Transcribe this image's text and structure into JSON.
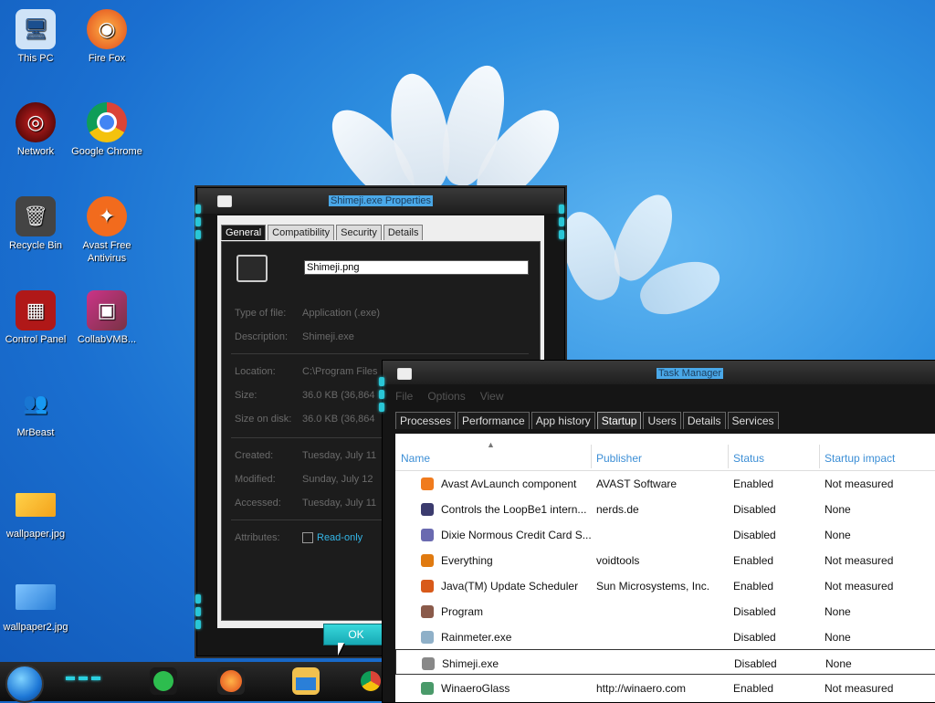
{
  "desktop": {
    "icons": [
      {
        "label": "This PC",
        "icon": "computer-icon"
      },
      {
        "label": "Fire Fox",
        "icon": "firefox-icon"
      },
      {
        "label": "Network",
        "icon": "network-icon"
      },
      {
        "label": "Google Chrome",
        "icon": "chrome-icon"
      },
      {
        "label": "Recycle Bin",
        "icon": "recycle-bin-icon"
      },
      {
        "label": "Avast Free Antivirus",
        "icon": "avast-icon"
      },
      {
        "label": "Control Panel",
        "icon": "control-panel-icon"
      },
      {
        "label": "CollabVMB...",
        "icon": "collabvm-icon"
      },
      {
        "label": "MrBeast",
        "icon": "users-icon"
      },
      {
        "label": "wallpaper.jpg",
        "icon": "image-file-icon"
      },
      {
        "label": "wallpaper2.jpg",
        "icon": "image-file-icon"
      }
    ]
  },
  "properties": {
    "title": "Shimeji.exe Properties",
    "tabs": [
      "General",
      "Compatibility",
      "Security",
      "Details"
    ],
    "active_tab": "General",
    "filename": "Shimeji.png",
    "rows": [
      {
        "label": "Type of file:",
        "value": "Application (.exe)"
      },
      {
        "label": "Description:",
        "value": "Shimeji.exe"
      },
      {
        "label": "Location:",
        "value": "C:\\Program Files"
      },
      {
        "label": "Size:",
        "value": "36.0 KB (36,864"
      },
      {
        "label": "Size on disk:",
        "value": "36.0 KB (36,864"
      },
      {
        "label": "Created:",
        "value": "Tuesday, July 11"
      },
      {
        "label": "Modified:",
        "value": "Sunday, July 12"
      },
      {
        "label": "Accessed:",
        "value": "Tuesday, July 11"
      },
      {
        "label": "Attributes:",
        "value": ""
      }
    ],
    "readonly_label": "Read-only",
    "ok_label": "OK"
  },
  "taskmgr": {
    "title": "Task Manager",
    "menu": [
      "File",
      "Options",
      "View"
    ],
    "tabs": [
      "Processes",
      "Performance",
      "App history",
      "Startup",
      "Users",
      "Details",
      "Services"
    ],
    "active_tab": "Startup",
    "columns": [
      "Name",
      "Publisher",
      "Status",
      "Startup impact"
    ],
    "rows": [
      {
        "name": "Avast AvLaunch component",
        "publisher": "AVAST Software",
        "status": "Enabled",
        "impact": "Not measured",
        "color": "#f07b1d"
      },
      {
        "name": "Controls the LoopBe1 intern...",
        "publisher": "nerds.de",
        "status": "Disabled",
        "impact": "None",
        "color": "#3b3b6e"
      },
      {
        "name": "Dixie Normous Credit Card S...",
        "publisher": "",
        "status": "Disabled",
        "impact": "None",
        "color": "#6a6ab0"
      },
      {
        "name": "Everything",
        "publisher": "voidtools",
        "status": "Enabled",
        "impact": "Not measured",
        "color": "#e07a10"
      },
      {
        "name": "Java(TM) Update Scheduler",
        "publisher": "Sun Microsystems, Inc.",
        "status": "Enabled",
        "impact": "Not measured",
        "color": "#d85a1a"
      },
      {
        "name": "Program",
        "publisher": "",
        "status": "Disabled",
        "impact": "None",
        "color": "#8a5a4a"
      },
      {
        "name": "Rainmeter.exe",
        "publisher": "",
        "status": "Disabled",
        "impact": "None",
        "color": "#8fb0c8"
      },
      {
        "name": "Shimeji.exe",
        "publisher": "",
        "status": "Disabled",
        "impact": "None",
        "color": "#888888"
      },
      {
        "name": "WinaeroGlass",
        "publisher": "http://winaero.com",
        "status": "Enabled",
        "impact": "Not measured",
        "color": "#4a9a6a"
      }
    ],
    "selected_row": 7
  },
  "taskbar": {
    "apps": [
      "notes-app-icon",
      "firefox-icon",
      "file-explorer-icon",
      "chrome-icon"
    ]
  }
}
